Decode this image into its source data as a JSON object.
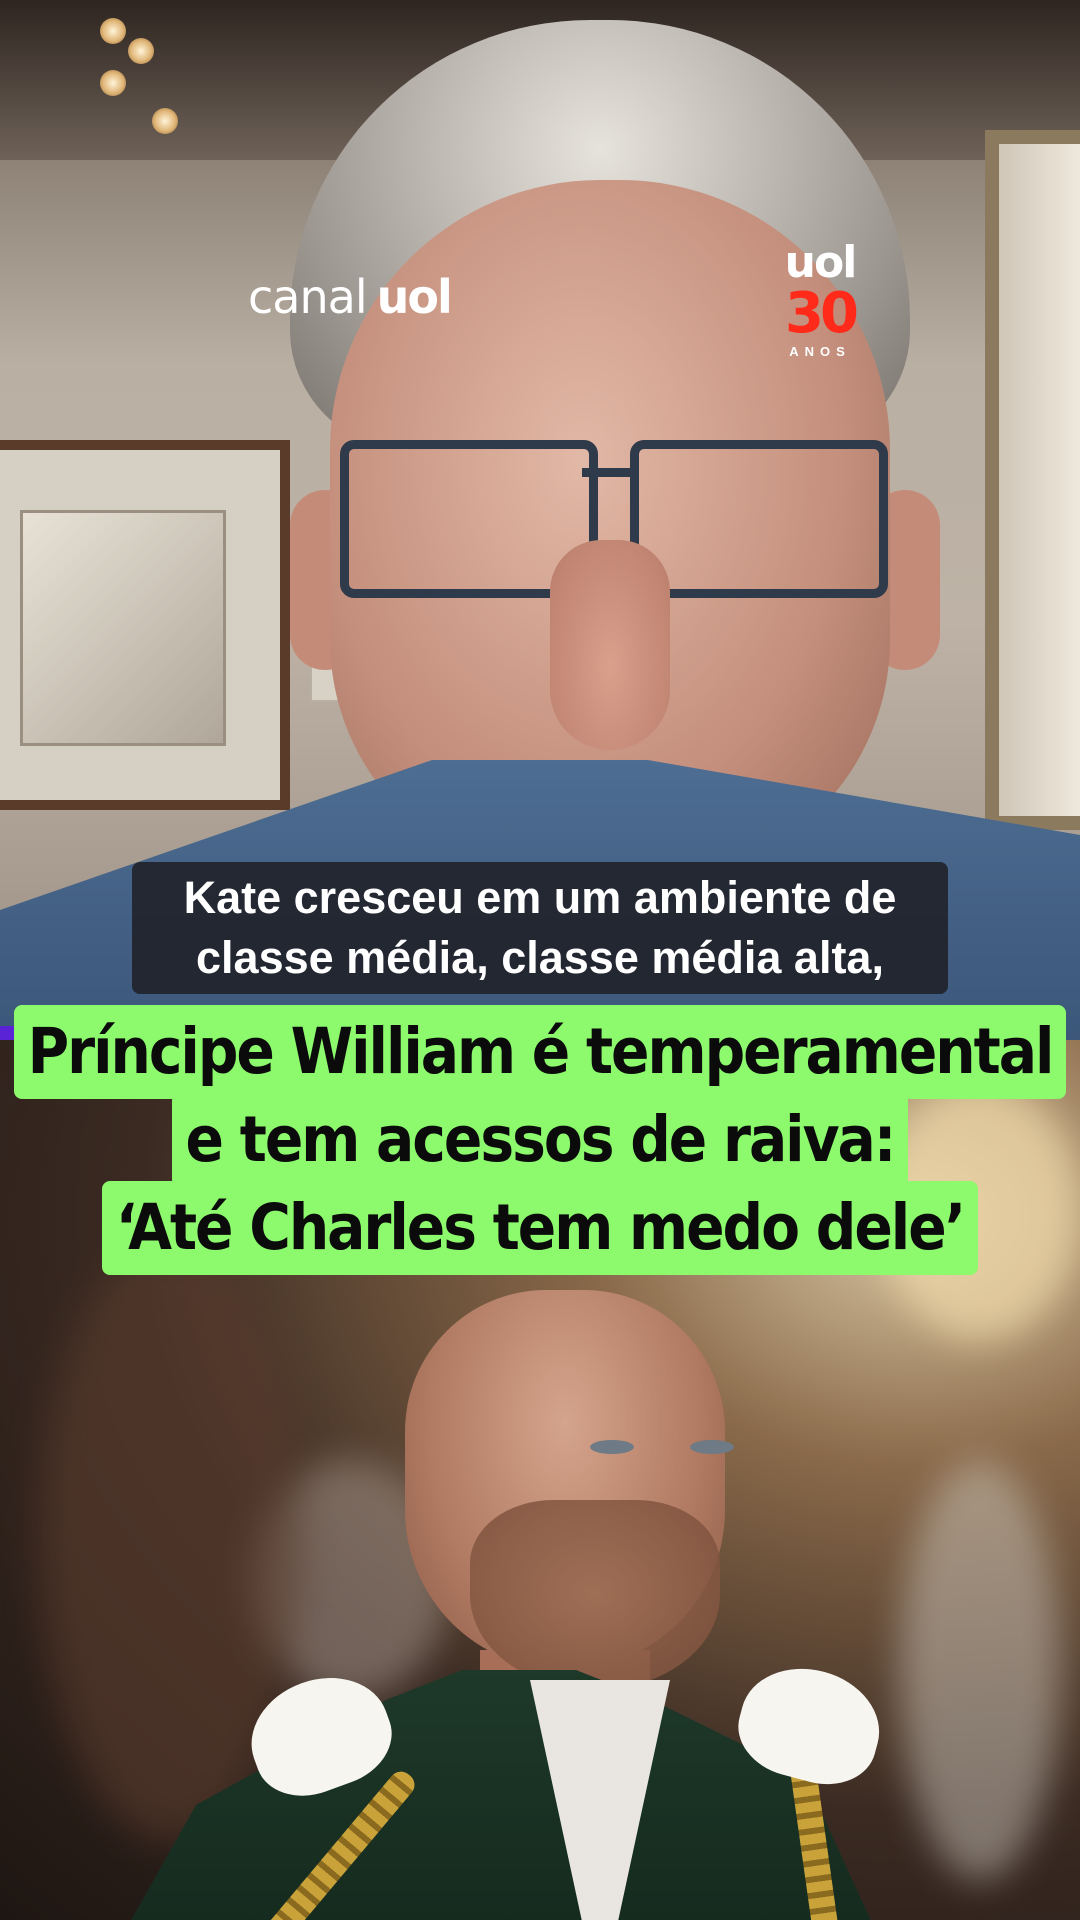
{
  "brand": {
    "channel_word1": "canal",
    "channel_word2": "uol",
    "anniversary_logo": "uol",
    "anniversary_number": "30",
    "anniversary_label": "ANOS",
    "anniversary_number_color": "#ff2a1a"
  },
  "subtitle": {
    "line1": "Kate cresceu em um ambiente de",
    "line2": "classe média, classe média alta,"
  },
  "headline": {
    "line1": "Príncipe William é temperamental",
    "line2": "e tem acessos de raiva:",
    "line3": "‘Até Charles tem medo dele’",
    "background_color": "#8cfa6c"
  },
  "accent_color": "#5a23d6"
}
